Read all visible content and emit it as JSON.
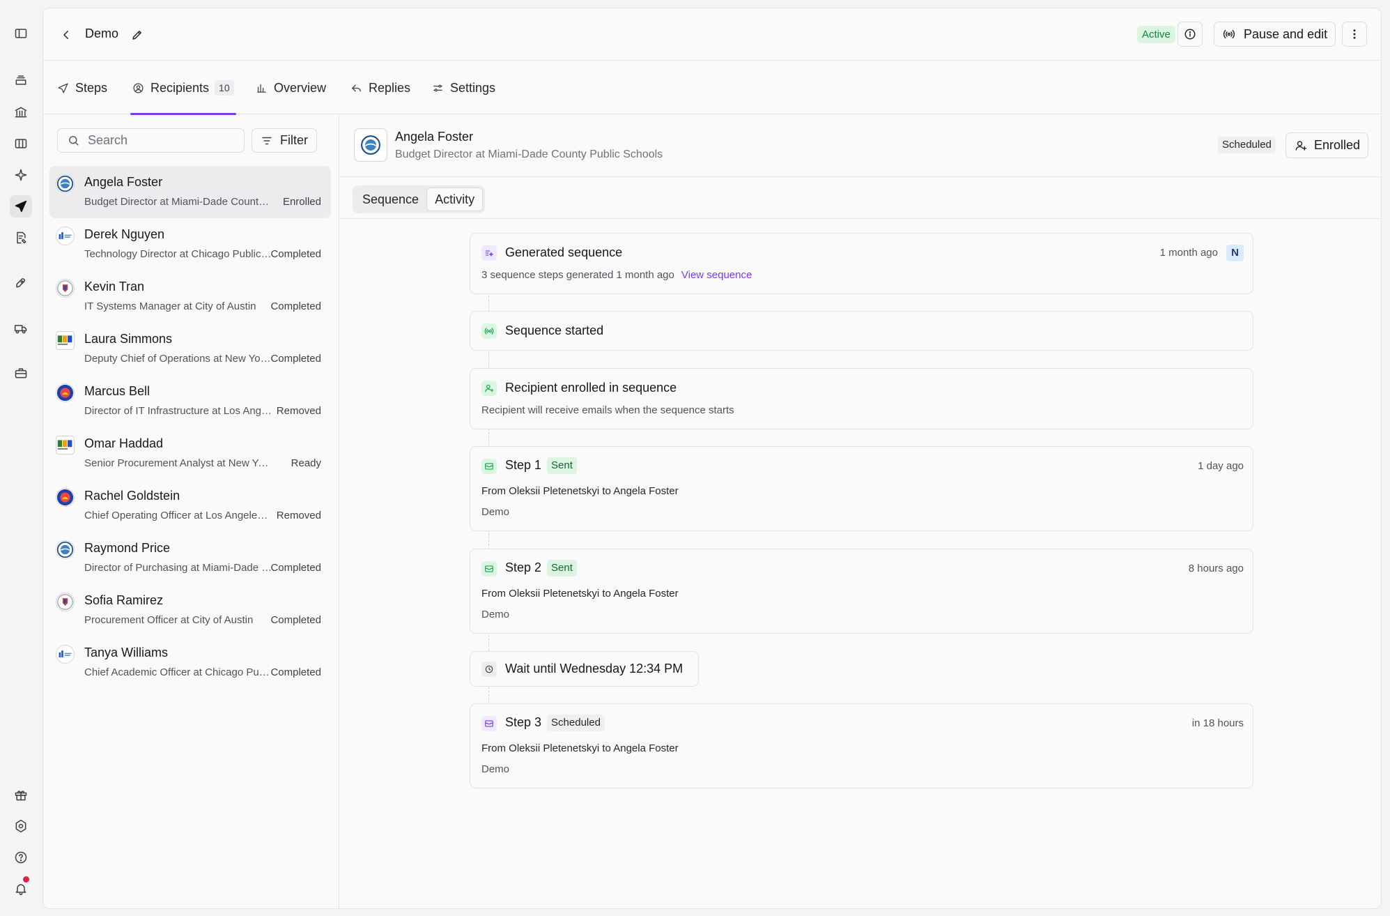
{
  "header": {
    "title": "Demo",
    "status": "Active",
    "pause_label": "Pause and edit"
  },
  "tabs": [
    {
      "label": "Steps"
    },
    {
      "label": "Recipients",
      "count": "10"
    },
    {
      "label": "Overview"
    },
    {
      "label": "Replies"
    },
    {
      "label": "Settings"
    }
  ],
  "search": {
    "placeholder": "Search"
  },
  "filter_label": "Filter",
  "recipients": [
    {
      "name": "Angela Foster",
      "title": "Budget Director at Miami-Dade County Public Schools",
      "status": "Enrolled",
      "logo": "miami-dade-seal"
    },
    {
      "name": "Derek Nguyen",
      "title": "Technology Director at Chicago Public Schools",
      "status": "Completed",
      "logo": "chicago-cps-logo"
    },
    {
      "name": "Kevin Tran",
      "title": "IT Systems Manager at City of Austin",
      "status": "Completed",
      "logo": "austin-seal"
    },
    {
      "name": "Laura Simmons",
      "title": "Deputy Chief of Operations at New York City Department of Education",
      "status": "Completed",
      "logo": "nyc-doe-logo"
    },
    {
      "name": "Marcus Bell",
      "title": "Director of IT Infrastructure at Los Angeles Unified School District",
      "status": "Removed",
      "logo": "lausd-seal"
    },
    {
      "name": "Omar Haddad",
      "title": "Senior Procurement Analyst at New York City Department of Education",
      "status": "Ready",
      "logo": "nyc-doe-logo"
    },
    {
      "name": "Rachel Goldstein",
      "title": "Chief Operating Officer at Los Angeles Unified School District",
      "status": "Removed",
      "logo": "lausd-seal"
    },
    {
      "name": "Raymond Price",
      "title": "Director of Purchasing at Miami-Dade County Public Schools",
      "status": "Completed",
      "logo": "miami-dade-seal"
    },
    {
      "name": "Sofia Ramirez",
      "title": "Procurement Officer at City of Austin",
      "status": "Completed",
      "logo": "austin-seal"
    },
    {
      "name": "Tanya Williams",
      "title": "Chief Academic Officer at Chicago Public Schools",
      "status": "Completed",
      "logo": "chicago-cps-logo"
    }
  ],
  "detail": {
    "name": "Angela Foster",
    "title": "Budget Director at Miami-Dade County Public Schools",
    "status_badge": "Scheduled",
    "enrolled_label": "Enrolled",
    "subtabs": [
      "Sequence",
      "Activity"
    ],
    "selected_subtab": "Activity"
  },
  "timeline": [
    {
      "icon": "sparkle-list-icon",
      "title": "Generated sequence",
      "right": "1 month ago",
      "badge": "N",
      "sub": "3 sequence steps generated 1 month ago",
      "link": "View sequence"
    },
    {
      "icon": "broadcast-icon",
      "title": "Sequence started"
    },
    {
      "icon": "user-plus-icon",
      "title": "Recipient enrolled in sequence",
      "sub": "Recipient will receive emails when the sequence starts"
    },
    {
      "icon": "mail-icon",
      "title": "Step 1",
      "badge": "Sent",
      "right": "1 day ago",
      "line1": "From Oleksii Pletenetskyi to Angela Foster",
      "line2": "Demo"
    },
    {
      "icon": "mail-icon",
      "title": "Step 2",
      "badge": "Sent",
      "right": "8 hours ago",
      "line1": "From Oleksii Pletenetskyi to Angela Foster",
      "line2": "Demo"
    },
    {
      "icon": "clock-icon",
      "title": "Wait until Wednesday 12:34 PM"
    },
    {
      "icon": "mail-icon",
      "title": "Step 3",
      "badge": "Scheduled",
      "right": "in 18 hours",
      "line1": "From Oleksii Pletenetskyi to Angela Foster",
      "line2": "Demo"
    }
  ],
  "colors": {
    "accent": "#7c3aed",
    "success": "#16a34a",
    "success_bg": "#dcf5e3",
    "notification": "#e11d48"
  }
}
